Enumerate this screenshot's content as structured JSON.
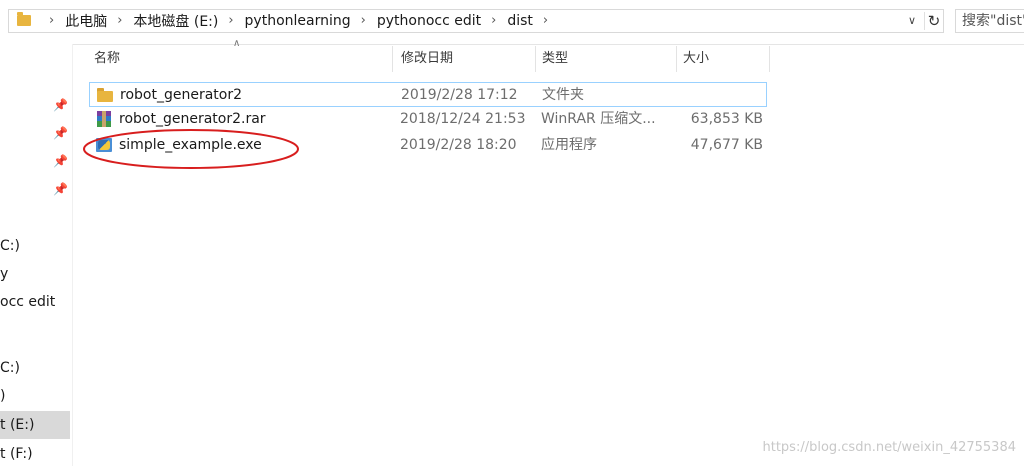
{
  "address_bar": {
    "crumbs": [
      "此电脑",
      "本地磁盘 (E:)",
      "pythonlearning",
      "pythonocc edit",
      "dist"
    ],
    "search_placeholder": "搜索\"dist\""
  },
  "nav_pane": {
    "items": [
      {
        "label": "C:)"
      },
      {
        "label": "y"
      },
      {
        "label": "occ edit"
      },
      {
        "label": "C:)"
      },
      {
        "label": ")"
      },
      {
        "label": "t (E:)"
      },
      {
        "label": "t (F:)"
      }
    ]
  },
  "columns": {
    "name": "名称",
    "date": "修改日期",
    "type": "类型",
    "size": "大小"
  },
  "files": [
    {
      "name": "robot_generator2",
      "date": "2019/2/28 17:12",
      "type": "文件夹",
      "size": "",
      "icon": "folder-icon"
    },
    {
      "name": "robot_generator2.rar",
      "date": "2018/12/24 21:53",
      "type": "WinRAR 压缩文...",
      "size": "63,853 KB",
      "icon": "rar-archive-icon"
    },
    {
      "name": "simple_example.exe",
      "date": "2019/2/28 18:20",
      "type": "应用程序",
      "size": "47,677 KB",
      "icon": "exe-file-icon"
    }
  ],
  "icons": {
    "dropdown": "chevron-down-icon",
    "refresh": "refresh-icon",
    "pin": "pin-icon"
  },
  "colors": {
    "selection_border": "#99d1ff",
    "annotation": "#d81e1e",
    "folder": "#e8b53f"
  },
  "watermark": "https://blog.csdn.net/weixin_42755384"
}
